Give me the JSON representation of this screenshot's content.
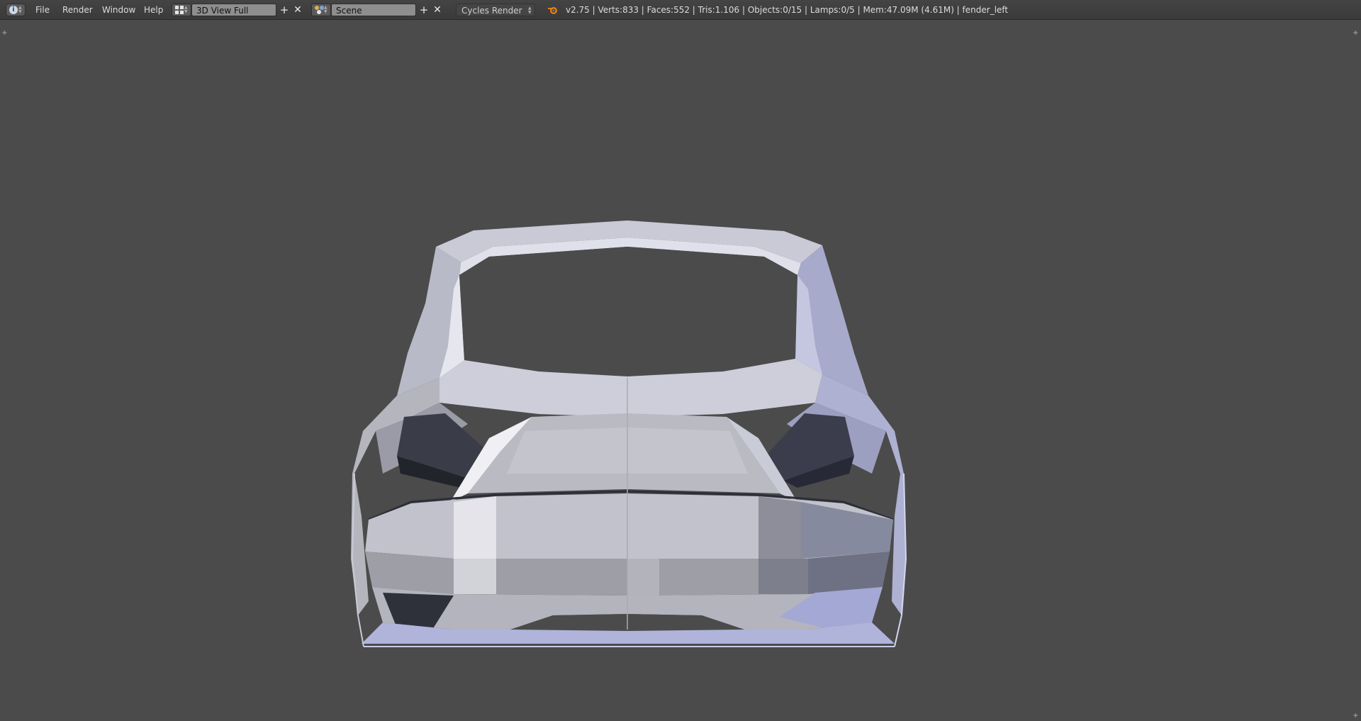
{
  "header": {
    "menus": [
      "File",
      "Render",
      "Window",
      "Help"
    ],
    "screen_layout": "3D View Full",
    "scene": "Scene",
    "render_engine": "Cycles Render",
    "stats": "v2.75 | Verts:833 | Faces:552 | Tris:1.106 | Objects:0/15 | Lamps:0/5 | Mem:47.09M (4.61M) | fender_left",
    "icons": {
      "editor_type": "info-icon",
      "layout": "screen-layout-icon",
      "scene": "scene-icon",
      "add": "plus-icon",
      "remove": "close-icon",
      "logo": "blender-logo-icon"
    }
  },
  "viewport": {
    "object": "car-body-mesh",
    "colors": {
      "background": "#4b4b4b",
      "mesh_light": "#d9dae2",
      "mesh_shadow": "#3d3f4e",
      "mesh_tint": "#a5a9d8"
    }
  }
}
